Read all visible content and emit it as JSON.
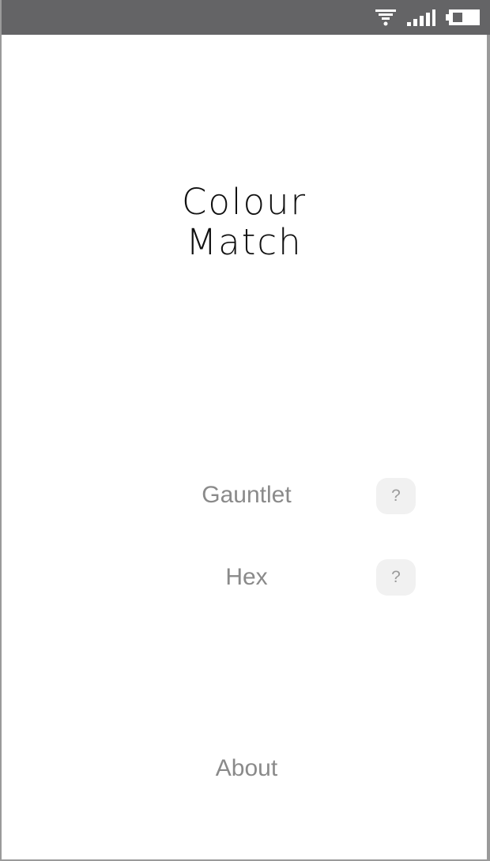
{
  "status_bar": {
    "icons": [
      "wifi-icon",
      "signal-icon",
      "battery-icon"
    ],
    "background_color": "#646466"
  },
  "app": {
    "title_line1": "Colour",
    "title_line2": "Match"
  },
  "menu": {
    "gauntlet_label": "Gauntlet",
    "gauntlet_help_label": "?",
    "hex_label": "Hex",
    "hex_help_label": "?",
    "about_label": "About"
  },
  "colors": {
    "menu_text": "#8a8a8a",
    "title_text": "#111111",
    "help_button_bg": "#f1f1f1"
  }
}
